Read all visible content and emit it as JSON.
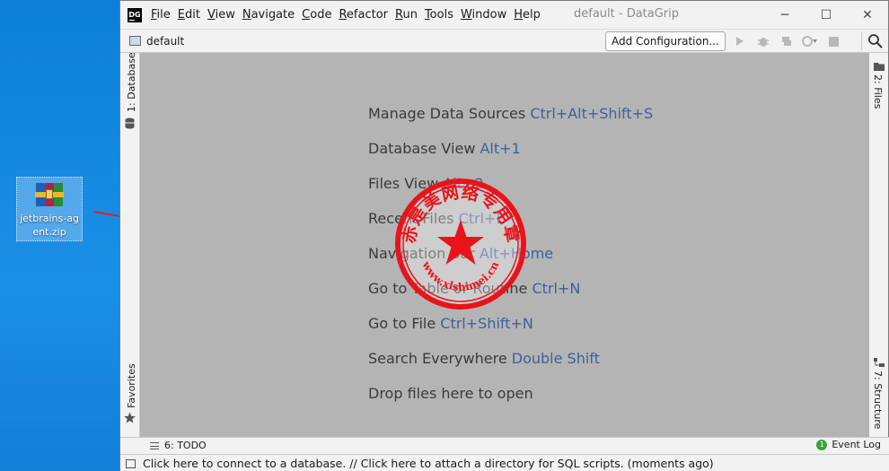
{
  "desktop": {
    "icon_label": "jetbrains-agent.zip"
  },
  "window": {
    "logo_text": "DG",
    "title": "default - DataGrip",
    "menu": [
      {
        "u": "F",
        "rest": "ile"
      },
      {
        "u": "E",
        "rest": "dit"
      },
      {
        "u": "V",
        "rest": "iew"
      },
      {
        "u": "N",
        "rest": "avigate"
      },
      {
        "u": "C",
        "rest": "ode"
      },
      {
        "u": "R",
        "rest": "efactor"
      },
      {
        "u": "R",
        "rest": "un"
      },
      {
        "u": "T",
        "rest": "ools"
      },
      {
        "u": "W",
        "rest": "indow"
      },
      {
        "u": "H",
        "rest": "elp"
      }
    ],
    "controls": {
      "minimize": "─",
      "maximize": "☐",
      "close": "✕"
    }
  },
  "toolbar": {
    "project_name": "default",
    "add_configuration": "Add Configuration..."
  },
  "side_tabs": {
    "database": "1: Database",
    "favorites": "Favorites",
    "files": "2: Files",
    "structure": "7: Structure"
  },
  "hints": [
    {
      "text": "Manage Data Sources ",
      "key": "Ctrl+Alt+Shift+S"
    },
    {
      "text": "Database View ",
      "key": "Alt+1"
    },
    {
      "text": "Files View ",
      "key": "Alt+2"
    },
    {
      "text": "Recent Files ",
      "key": "Ctrl+E"
    },
    {
      "text": "Navigation Bar ",
      "key": "Alt+Home"
    },
    {
      "text": "Go to Table or Routine ",
      "key": "Ctrl+N"
    },
    {
      "text": "Go to File ",
      "key": "Ctrl+Shift+N"
    },
    {
      "text": "Search Everywhere ",
      "key": "Double Shift"
    },
    {
      "text": "Drop files here to open",
      "key": ""
    }
  ],
  "stamp": {
    "top_text": "赤是美网络专用章",
    "bottom_text": "www.xlshimei.cn",
    "color": "#e8141c"
  },
  "bottom": {
    "todo": "6: TODO",
    "event_log": "Event Log",
    "event_count": "1"
  },
  "status": {
    "message": "Click here to connect to a database. // Click here to attach a directory for SQL scripts. (moments ago)"
  }
}
